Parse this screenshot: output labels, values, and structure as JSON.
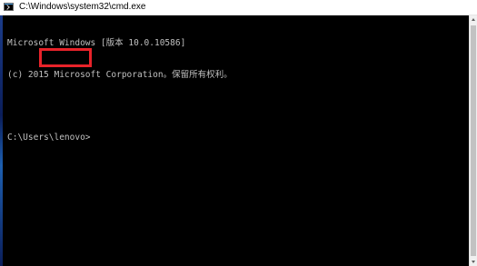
{
  "window": {
    "title": "C:\\Windows\\system32\\cmd.exe",
    "app_icon": "cmd-icon"
  },
  "console": {
    "lines": [
      "Microsoft Windows [版本 10.0.10586]",
      "(c) 2015 Microsoft Corporation。保留所有权利。",
      "",
      "C:\\Users\\lenovo>"
    ],
    "text_color": "#c0c0c0",
    "background_color": "#000000"
  },
  "annotation": {
    "highlight_color": "#e8232a"
  },
  "scrollbar": {
    "up_icon": "scroll-up-arrow-icon",
    "down_icon": "scroll-down-arrow-icon"
  }
}
